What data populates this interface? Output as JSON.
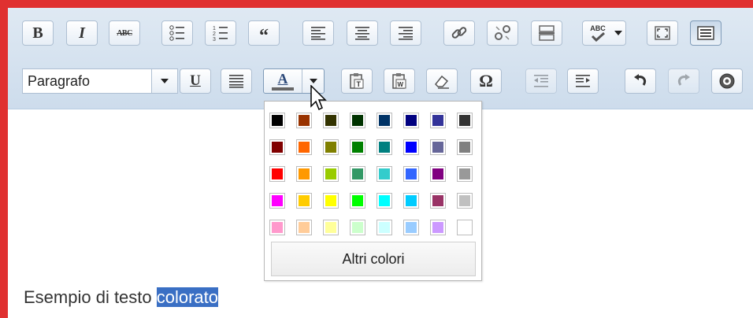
{
  "toolbar": {
    "bold_label": "B",
    "italic_label": "I",
    "strikethrough_label": "ABC",
    "spellcheck_label": "ABC",
    "format_select_value": "Paragrafo",
    "underline_label": "U",
    "forecolor_label": "A",
    "special_char_label": "Ω"
  },
  "color_picker": {
    "swatches": [
      [
        "#000000",
        "#993300",
        "#333300",
        "#003300",
        "#003366",
        "#000080",
        "#333399",
        "#333333"
      ],
      [
        "#800000",
        "#FF6600",
        "#808000",
        "#008000",
        "#008080",
        "#0000FF",
        "#666699",
        "#808080"
      ],
      [
        "#FF0000",
        "#FF9900",
        "#99CC00",
        "#339966",
        "#33CCCC",
        "#3366FF",
        "#800080",
        "#999999"
      ],
      [
        "#FF00FF",
        "#FFCC00",
        "#FFFF00",
        "#00FF00",
        "#00FFFF",
        "#00CCFF",
        "#993366",
        "#C0C0C0"
      ],
      [
        "#FF99CC",
        "#FFCC99",
        "#FFFF99",
        "#CCFFCC",
        "#CCFFFF",
        "#99CCFF",
        "#CC99FF",
        "#FFFFFF"
      ]
    ],
    "more_colors_label": "Altri colori"
  },
  "editor": {
    "text_before": "Esempio di testo ",
    "text_selected": "colorato"
  }
}
